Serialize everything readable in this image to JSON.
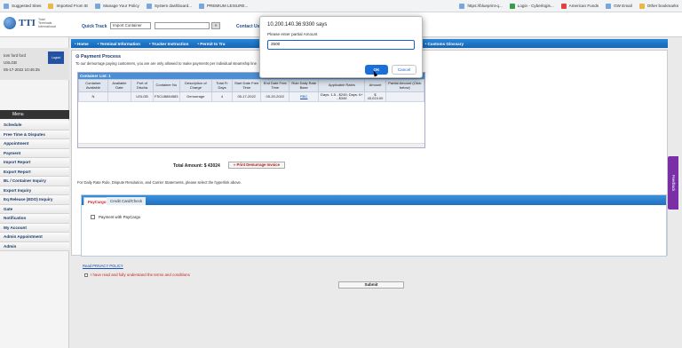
{
  "bookmarks": {
    "left": [
      "Suggested Sites",
      "Imported From IE",
      "Manage Your Policy",
      "System dashboard...",
      "PREMIUM LEISURE..."
    ],
    "right": [
      "https://blueprint-q...",
      "Login - Cyberlogis...",
      "American Funds",
      "GW Email",
      "Other bookmarks"
    ]
  },
  "header": {
    "logo": "TTI",
    "logo_sub": "Total Terminals International",
    "quick_track_label": "Quick Track",
    "quick_track_select": "Import Container",
    "contact": "Contact Us"
  },
  "sidebar": {
    "user_line1": "tom ford ford",
    "user_line2": "USLGB",
    "user_line3": "05-17-2022 10:45:35",
    "logout": "Logout",
    "menu_label": "Menu",
    "items": [
      "Schedule",
      "Free Time & Disputes",
      "Appointment",
      "Payment",
      "Import Report",
      "Export Report",
      "BL / Container Inquiry",
      "Export Inquiry",
      "Eq Release (EDO) Inquiry",
      "Gate",
      "Notification",
      "My Account",
      "Admin Appointment",
      "Admin"
    ]
  },
  "navbar": {
    "items": [
      "Home",
      "Terminal Information",
      "Trucker Instruction",
      "Permit to Tra",
      "Map",
      "Customs Glossary"
    ]
  },
  "content": {
    "title": "Payment Process",
    "note": "To our demurrage paying customers, you are are only allowed to make payments per individual steamship line",
    "table_title": "Container List: 1",
    "columns": [
      "Container Available",
      "Available Date",
      "Port of Discha",
      "Container No",
      "Description of Charge",
      "Total Fr Days",
      "Start Date Free Time",
      "End Date Free Time",
      "Rule Daily Rate Base",
      "Applicable Rates",
      "Amount",
      "Partial Amount (Click below)"
    ],
    "rows": [
      [
        "N",
        "",
        "USLGB",
        "FSCU8884583",
        "Demurrage",
        "4",
        "05-17-2022",
        "05-20-2022",
        "RBC",
        "Days: 1-5 - $245; Days: 6+ - $345",
        "$ 43,024.00",
        ""
      ]
    ],
    "total_label": "Total Amount: $ 43024",
    "print_button": "Print Demurrage Invoice",
    "daily_note": "For Daily Rate Rule, Dispute Resolution, and Carrier Statements, please select the hyperlink above.",
    "tab_paycargo": "PayCargo",
    "tab_card": "Credit Card/Check",
    "pay_with": "Payment with PayCargo",
    "privacy": "Read PRIVACY POLICY",
    "agree": "I have read and fully understand the terms and conditions",
    "submit": "Submit"
  },
  "feedback": "Feedback",
  "dialog": {
    "title": "10.200.140.36:9300 says",
    "message": "Please enter partial Amount",
    "value": "2500",
    "ok": "OK",
    "cancel": "Cancel"
  }
}
